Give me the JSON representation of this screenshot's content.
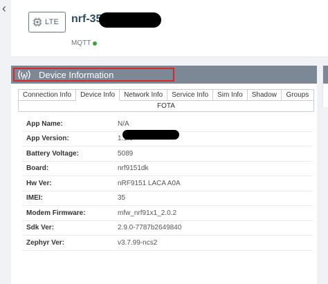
{
  "nav": {
    "back_glyph": "‹"
  },
  "device": {
    "chip_label": "LTE",
    "name": "nrf-35",
    "protocol": "MQTT",
    "status_color": "#3aa53a"
  },
  "panel": {
    "title": "Device Information",
    "tabs": [
      "Connection Info",
      "Device Info",
      "Network Info",
      "Service Info",
      "Sim Info",
      "Shadow",
      "Groups"
    ],
    "active_tab": "Device Info",
    "tabs_row2": [
      "FOTA"
    ]
  },
  "info_rows": [
    {
      "key": "App Name:",
      "value": "N/A"
    },
    {
      "key": "App Version:",
      "value": "1.1.0"
    },
    {
      "key": "Battery Voltage:",
      "value": "5089"
    },
    {
      "key": "Board:",
      "value": "nrf9151dk"
    },
    {
      "key": "Hw Ver:",
      "value": "nRF9151 LACA A0A"
    },
    {
      "key": "IMEI:",
      "value": "35"
    },
    {
      "key": "Modem Firmware:",
      "value": "mfw_nrf91x1_2.0.2"
    },
    {
      "key": "Sdk Ver:",
      "value": "2.9.0-7787b2649840"
    },
    {
      "key": "Zephyr Ver:",
      "value": "v3.7.99-ncs2"
    }
  ]
}
